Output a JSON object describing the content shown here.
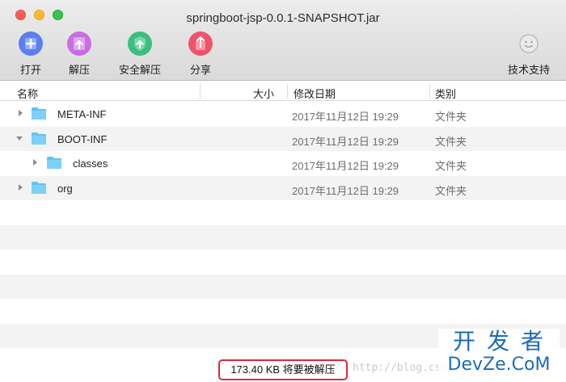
{
  "window": {
    "title": "springboot-jsp-0.0.1-SNAPSHOT.jar"
  },
  "toolbar": {
    "open_label": "打开",
    "extract_label": "解压",
    "safe_extract_label": "安全解压",
    "share_label": "分享",
    "support_label": "技术支持"
  },
  "columns": {
    "name": "名称",
    "size": "大小",
    "modified": "修改日期",
    "kind": "类别"
  },
  "rows": [
    {
      "name": "META-INF",
      "date": "2017年11月12日 19:29",
      "kind": "文件夹",
      "expanded": false
    },
    {
      "name": "BOOT-INF",
      "date": "2017年11月12日 19:29",
      "kind": "文件夹",
      "expanded": true
    },
    {
      "name": "classes",
      "date": "2017年11月12日 19:29",
      "kind": "文件夹",
      "expanded": false
    },
    {
      "name": "org",
      "date": "2017年11月12日 19:29",
      "kind": "文件夹",
      "expanded": false
    }
  ],
  "status": {
    "text": "173.40 KB 将要被解压"
  },
  "watermark": {
    "text": "http://blog.csd"
  },
  "logo": {
    "top": "开发者",
    "bottom": "DevZe.CoM"
  },
  "colors": {
    "open": "#5b7ff0",
    "extract": "#c76fe0",
    "safe_extract": "#3bbf7d",
    "share": "#f0536a",
    "folder": "#5fc3f5",
    "status_border": "#e0263b",
    "logo": "#1b6bbd"
  }
}
